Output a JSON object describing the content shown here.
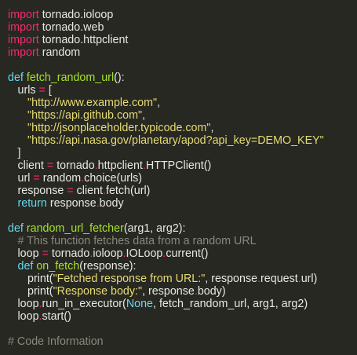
{
  "colors": {
    "background": "#272822",
    "keyword": "#f92672",
    "def": "#66d9ef",
    "function": "#a6e22e",
    "string": "#e6db74",
    "comment": "#8a887c",
    "text": "#e8e8e2"
  },
  "code": {
    "lines": [
      {
        "indent": 0,
        "tokens": [
          {
            "c": "kw",
            "t": "import"
          },
          {
            "c": "pl",
            "t": " tornado.ioloop"
          }
        ]
      },
      {
        "indent": 0,
        "tokens": [
          {
            "c": "kw",
            "t": "import"
          },
          {
            "c": "pl",
            "t": " tornado.web"
          }
        ]
      },
      {
        "indent": 0,
        "tokens": [
          {
            "c": "kw",
            "t": "import"
          },
          {
            "c": "pl",
            "t": " tornado.httpclient"
          }
        ]
      },
      {
        "indent": 0,
        "tokens": [
          {
            "c": "kw",
            "t": "import"
          },
          {
            "c": "pl",
            "t": " random"
          }
        ]
      },
      {
        "indent": 0,
        "tokens": []
      },
      {
        "indent": 0,
        "tokens": [
          {
            "c": "def",
            "t": "def "
          },
          {
            "c": "fn",
            "t": "fetch_random_url"
          },
          {
            "c": "pl",
            "t": "():"
          }
        ]
      },
      {
        "indent": 1,
        "tokens": [
          {
            "c": "pl",
            "t": "urls "
          },
          {
            "c": "op",
            "t": "="
          },
          {
            "c": "pl",
            "t": " ["
          }
        ]
      },
      {
        "indent": 2,
        "tokens": [
          {
            "c": "str",
            "t": "\"http://www.example.com\""
          },
          {
            "c": "pl",
            "t": ","
          }
        ]
      },
      {
        "indent": 2,
        "tokens": [
          {
            "c": "str",
            "t": "\"https://api.github.com\""
          },
          {
            "c": "pl",
            "t": ","
          }
        ]
      },
      {
        "indent": 2,
        "tokens": [
          {
            "c": "str",
            "t": "\"http://jsonplaceholder.typicode.com\""
          },
          {
            "c": "pl",
            "t": ","
          }
        ]
      },
      {
        "indent": 2,
        "tokens": [
          {
            "c": "str",
            "t": "\"https://api.nasa.gov/planetary/apod?api_key=DEMO_KEY\""
          }
        ]
      },
      {
        "indent": 1,
        "tokens": [
          {
            "c": "pl",
            "t": "]"
          }
        ]
      },
      {
        "indent": 1,
        "tokens": [
          {
            "c": "pl",
            "t": "client "
          },
          {
            "c": "op",
            "t": "="
          },
          {
            "c": "pl",
            "t": " tornado"
          },
          {
            "c": "op",
            "t": "."
          },
          {
            "c": "pl",
            "t": "httpclient"
          },
          {
            "c": "op",
            "t": "."
          },
          {
            "c": "pl",
            "t": "HTTPClient()"
          }
        ]
      },
      {
        "indent": 1,
        "tokens": [
          {
            "c": "pl",
            "t": "url "
          },
          {
            "c": "op",
            "t": "="
          },
          {
            "c": "pl",
            "t": " random"
          },
          {
            "c": "op",
            "t": "."
          },
          {
            "c": "pl",
            "t": "choice(urls)"
          }
        ]
      },
      {
        "indent": 1,
        "tokens": [
          {
            "c": "pl",
            "t": "response "
          },
          {
            "c": "op",
            "t": "="
          },
          {
            "c": "pl",
            "t": " client"
          },
          {
            "c": "op",
            "t": "."
          },
          {
            "c": "pl",
            "t": "fetch(url)"
          }
        ]
      },
      {
        "indent": 1,
        "tokens": [
          {
            "c": "def",
            "t": "return"
          },
          {
            "c": "pl",
            "t": " response"
          },
          {
            "c": "op",
            "t": "."
          },
          {
            "c": "pl",
            "t": "body"
          }
        ]
      },
      {
        "indent": 0,
        "tokens": []
      },
      {
        "indent": 0,
        "tokens": [
          {
            "c": "def",
            "t": "def "
          },
          {
            "c": "fn",
            "t": "random_url_fetcher"
          },
          {
            "c": "pl",
            "t": "(arg1, arg2):"
          }
        ]
      },
      {
        "indent": 1,
        "tokens": [
          {
            "c": "com",
            "t": "# This function fetches data from a random URL"
          }
        ]
      },
      {
        "indent": 1,
        "tokens": [
          {
            "c": "pl",
            "t": "loop "
          },
          {
            "c": "op",
            "t": "="
          },
          {
            "c": "pl",
            "t": " tornado"
          },
          {
            "c": "op",
            "t": "."
          },
          {
            "c": "pl",
            "t": "ioloop"
          },
          {
            "c": "op",
            "t": "."
          },
          {
            "c": "pl",
            "t": "IOLoop"
          },
          {
            "c": "op",
            "t": "."
          },
          {
            "c": "pl",
            "t": "current()"
          }
        ]
      },
      {
        "indent": 1,
        "tokens": [
          {
            "c": "def",
            "t": "def "
          },
          {
            "c": "fn",
            "t": "on_fetch"
          },
          {
            "c": "pl",
            "t": "(response):"
          }
        ]
      },
      {
        "indent": 2,
        "tokens": [
          {
            "c": "pl",
            "t": "print("
          },
          {
            "c": "str",
            "t": "\"Fetched response from URL:\""
          },
          {
            "c": "pl",
            "t": ", response"
          },
          {
            "c": "op",
            "t": "."
          },
          {
            "c": "pl",
            "t": "request"
          },
          {
            "c": "op",
            "t": "."
          },
          {
            "c": "pl",
            "t": "url)"
          }
        ]
      },
      {
        "indent": 2,
        "tokens": [
          {
            "c": "pl",
            "t": "print("
          },
          {
            "c": "str",
            "t": "\"Response body:\""
          },
          {
            "c": "pl",
            "t": ", response"
          },
          {
            "c": "op",
            "t": "."
          },
          {
            "c": "pl",
            "t": "body)"
          }
        ]
      },
      {
        "indent": 1,
        "tokens": [
          {
            "c": "pl",
            "t": "loop"
          },
          {
            "c": "op",
            "t": "."
          },
          {
            "c": "pl",
            "t": "run_in_executor("
          },
          {
            "c": "def",
            "t": "None"
          },
          {
            "c": "pl",
            "t": ", fetch_random_url, arg1, arg2)"
          }
        ]
      },
      {
        "indent": 1,
        "tokens": [
          {
            "c": "pl",
            "t": "loop"
          },
          {
            "c": "op",
            "t": "."
          },
          {
            "c": "pl",
            "t": "start()"
          }
        ]
      },
      {
        "indent": 0,
        "tokens": []
      },
      {
        "indent": 0,
        "tokens": [
          {
            "c": "com",
            "t": "# Code Information"
          }
        ]
      }
    ]
  }
}
